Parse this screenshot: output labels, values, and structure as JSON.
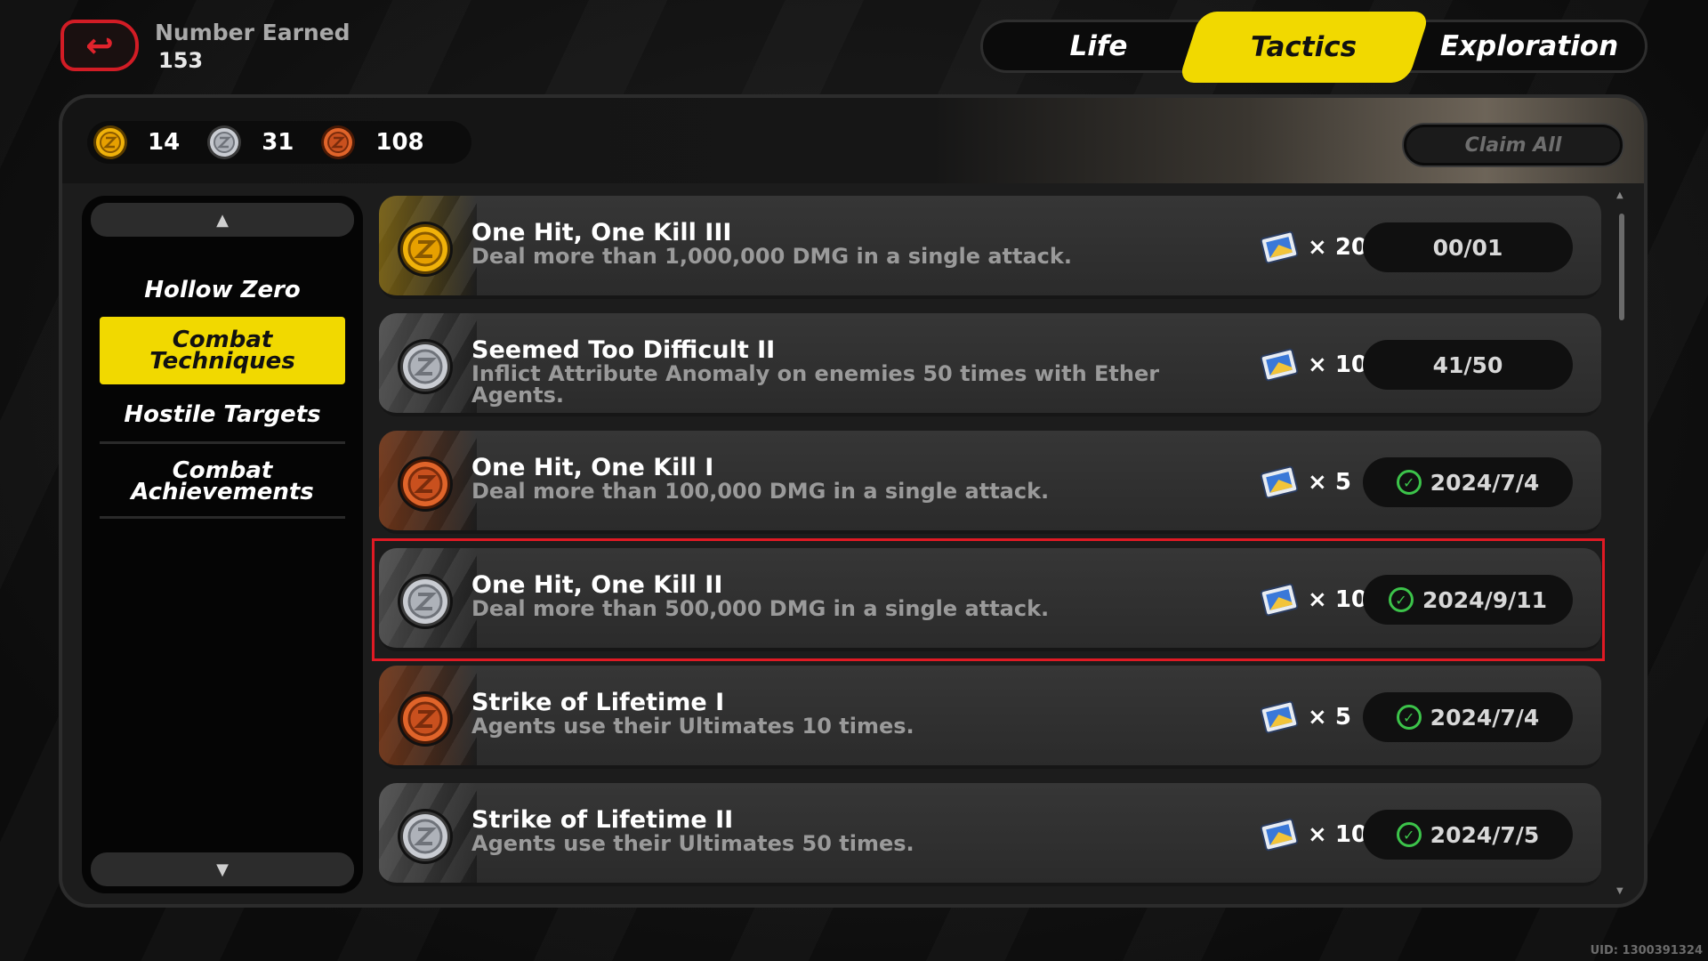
{
  "header": {
    "earned_label": "Number Earned",
    "earned_value": "153",
    "tabs": [
      {
        "label": "Life",
        "active": false
      },
      {
        "label": "Tactics",
        "active": true
      },
      {
        "label": "Exploration",
        "active": false
      }
    ]
  },
  "medals": {
    "gold": "14",
    "silver": "31",
    "bronze": "108"
  },
  "claim_all_label": "Claim All",
  "sidebar": {
    "items": [
      {
        "label": "Hollow Zero",
        "active": false
      },
      {
        "label": "Combat Techniques",
        "active": true
      },
      {
        "label": "Hostile Targets",
        "active": false
      },
      {
        "label": "Combat Achievements",
        "active": false
      }
    ]
  },
  "achievements": [
    {
      "tier": "gold",
      "title": "One Hit, One Kill III",
      "desc": "Deal more than 1,000,000 DMG in a single attack.",
      "reward": "× 20",
      "status": "00/01",
      "done": false
    },
    {
      "tier": "silver",
      "title": "Seemed Too Difficult II",
      "desc": "Inflict Attribute Anomaly on enemies 50 times with Ether Agents.",
      "reward": "× 10",
      "status": "41/50",
      "done": false
    },
    {
      "tier": "bronze",
      "title": "One Hit, One Kill I",
      "desc": "Deal more than 100,000 DMG in a single attack.",
      "reward": "× 5",
      "status": "2024/7/4",
      "done": true
    },
    {
      "tier": "silver",
      "title": "One Hit, One Kill II",
      "desc": "Deal more than 500,000 DMG in a single attack.",
      "reward": "× 10",
      "status": "2024/9/11",
      "done": true
    },
    {
      "tier": "bronze",
      "title": "Strike of Lifetime I",
      "desc": "Agents use their Ultimates 10 times.",
      "reward": "× 5",
      "status": "2024/7/4",
      "done": true
    },
    {
      "tier": "silver",
      "title": "Strike of Lifetime II",
      "desc": "Agents use their Ultimates 50 times.",
      "reward": "× 10",
      "status": "2024/7/5",
      "done": true
    }
  ],
  "uid": "UID: 1300391324",
  "colors": {
    "accent": "#f1d900",
    "highlight": "#e01a24",
    "check": "#3cc34a"
  }
}
